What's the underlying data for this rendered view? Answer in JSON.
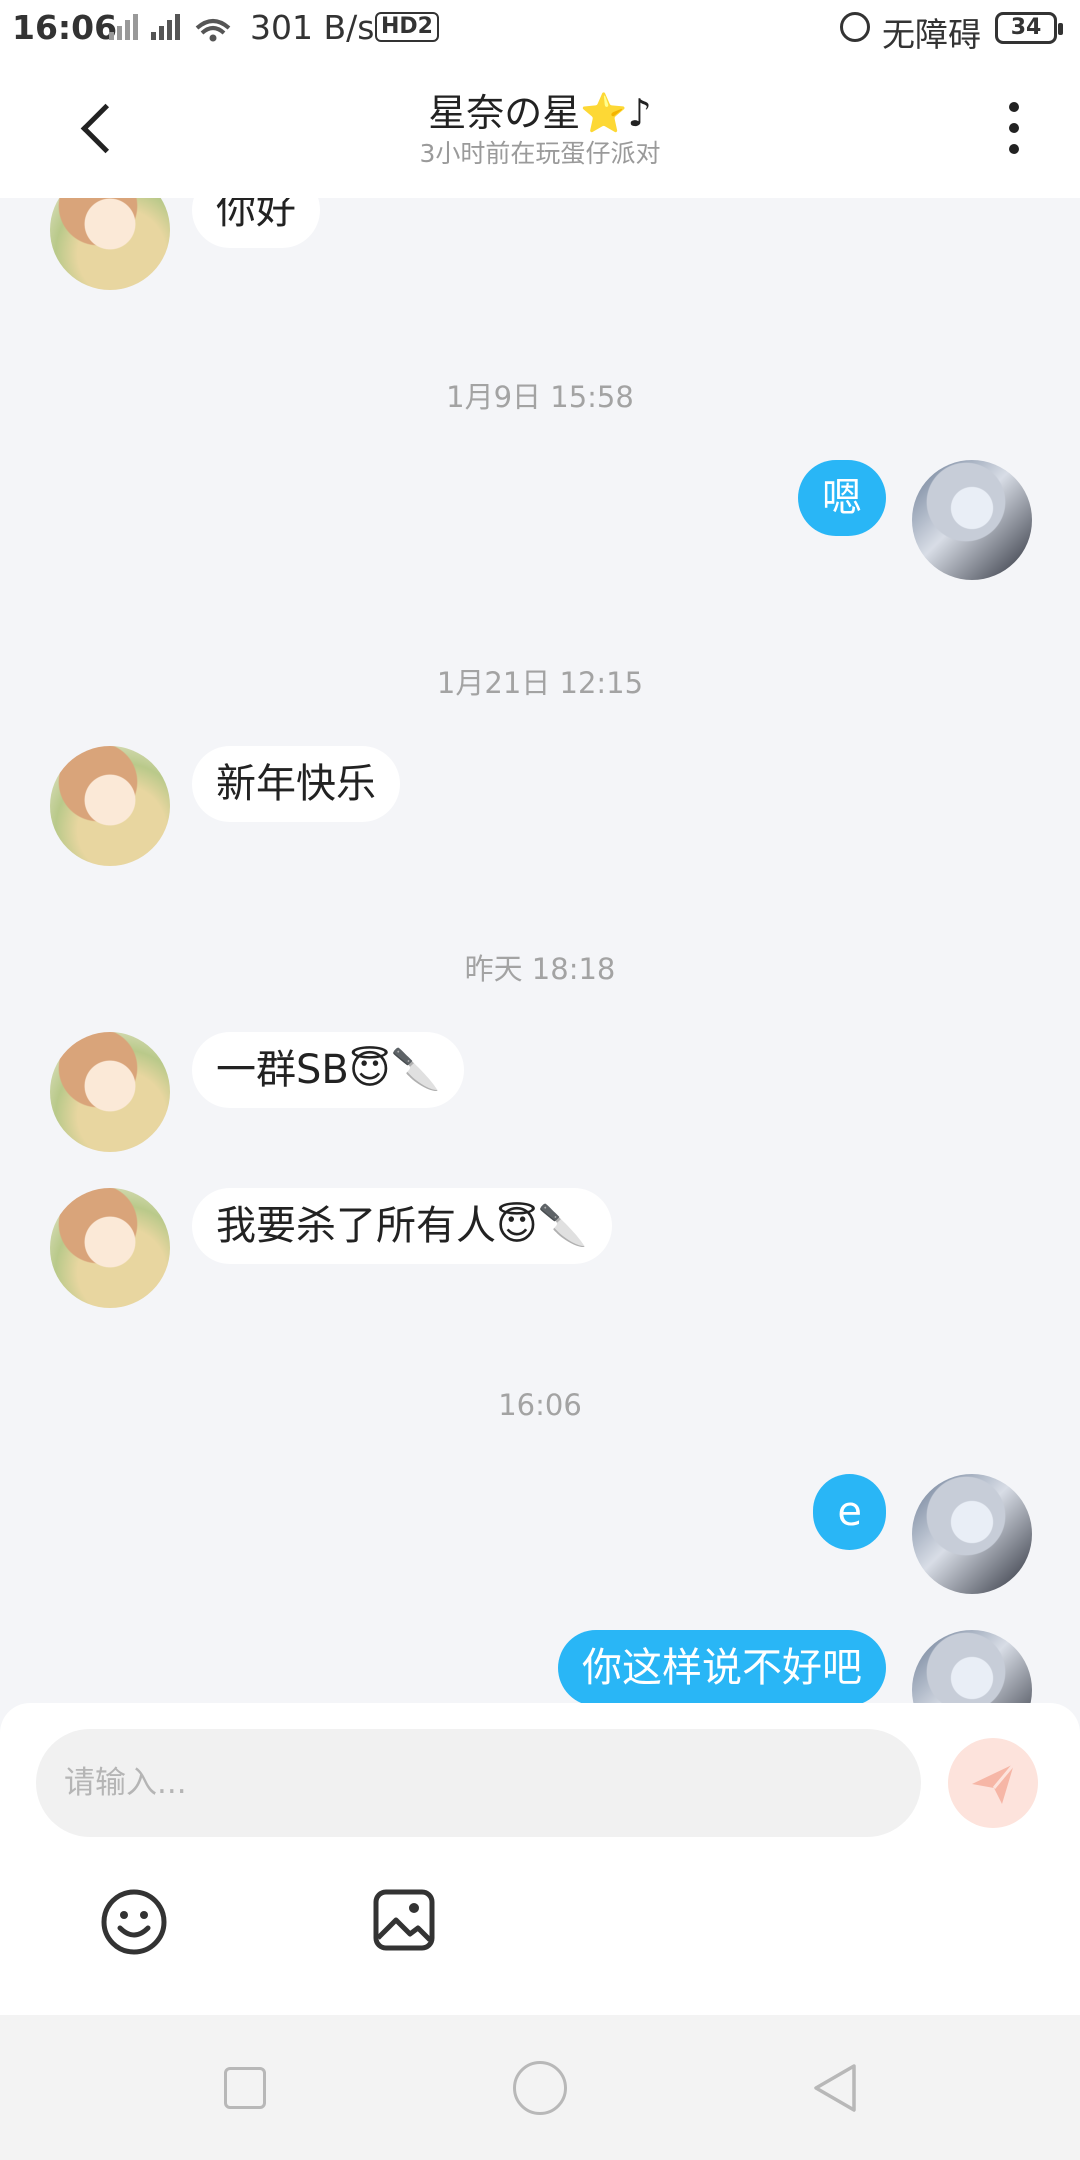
{
  "status_bar": {
    "time": "16:06",
    "network_speed": "301 B/s",
    "hd_badge": "HD2",
    "accessibility": "无障碍",
    "battery": "34"
  },
  "header": {
    "title": "星奈の星⭐♪",
    "subtitle": "3小时前在玩蛋仔派对"
  },
  "messages": [
    {
      "type": "in",
      "text": "你好"
    },
    {
      "type": "time",
      "text": "1月9日 15:58"
    },
    {
      "type": "out",
      "text": "嗯"
    },
    {
      "type": "time",
      "text": "1月21日 12:15"
    },
    {
      "type": "in",
      "text": "新年快乐"
    },
    {
      "type": "time",
      "text": "昨天 18:18"
    },
    {
      "type": "in",
      "text": "一群SB😇🔪"
    },
    {
      "type": "in",
      "text": "我要杀了所有人😇🔪"
    },
    {
      "type": "time",
      "text": "16:06"
    },
    {
      "type": "out",
      "text": "e"
    },
    {
      "type": "out",
      "text": "你这样说不好吧"
    }
  ],
  "composer": {
    "placeholder": "请输入...",
    "send_icon": "send-icon",
    "emoji_icon": "emoji-icon",
    "image_icon": "image-icon"
  },
  "icons": {
    "back": "back-arrow-icon",
    "more": "more-vertical-icon"
  },
  "colors": {
    "outgoing_bubble": "#29b6f6",
    "incoming_bubble": "#ffffff",
    "chat_background": "#f4f5f8"
  }
}
